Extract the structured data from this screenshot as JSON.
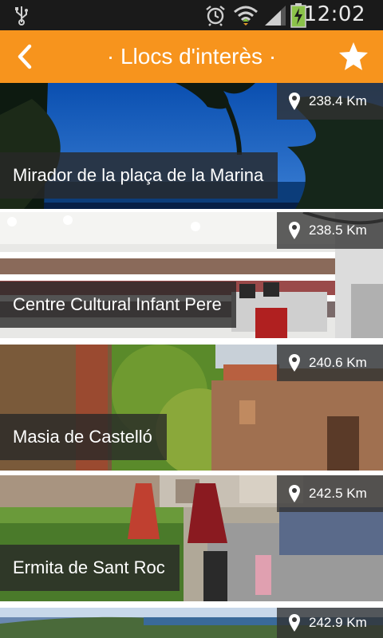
{
  "status_bar": {
    "time": "12:02",
    "icons": [
      "usb-icon",
      "alarm-icon",
      "wifi-icon",
      "signal-icon",
      "battery-charging-icon"
    ]
  },
  "header": {
    "title": "· Llocs d'interès ·",
    "back_icon": "chevron-left-icon",
    "favorite_icon": "star-icon",
    "background": "#f7941d"
  },
  "places": [
    {
      "name": "Mirador de la plaça de la Marina",
      "distance": "238.4 Km"
    },
    {
      "name": "Centre Cultural Infant Pere",
      "distance": "238.5 Km"
    },
    {
      "name": "Masia de Castelló",
      "distance": "240.6 Km"
    },
    {
      "name": "Ermita de Sant Roc",
      "distance": "242.5 Km"
    },
    {
      "name": "",
      "distance": "242.9 Km"
    }
  ]
}
